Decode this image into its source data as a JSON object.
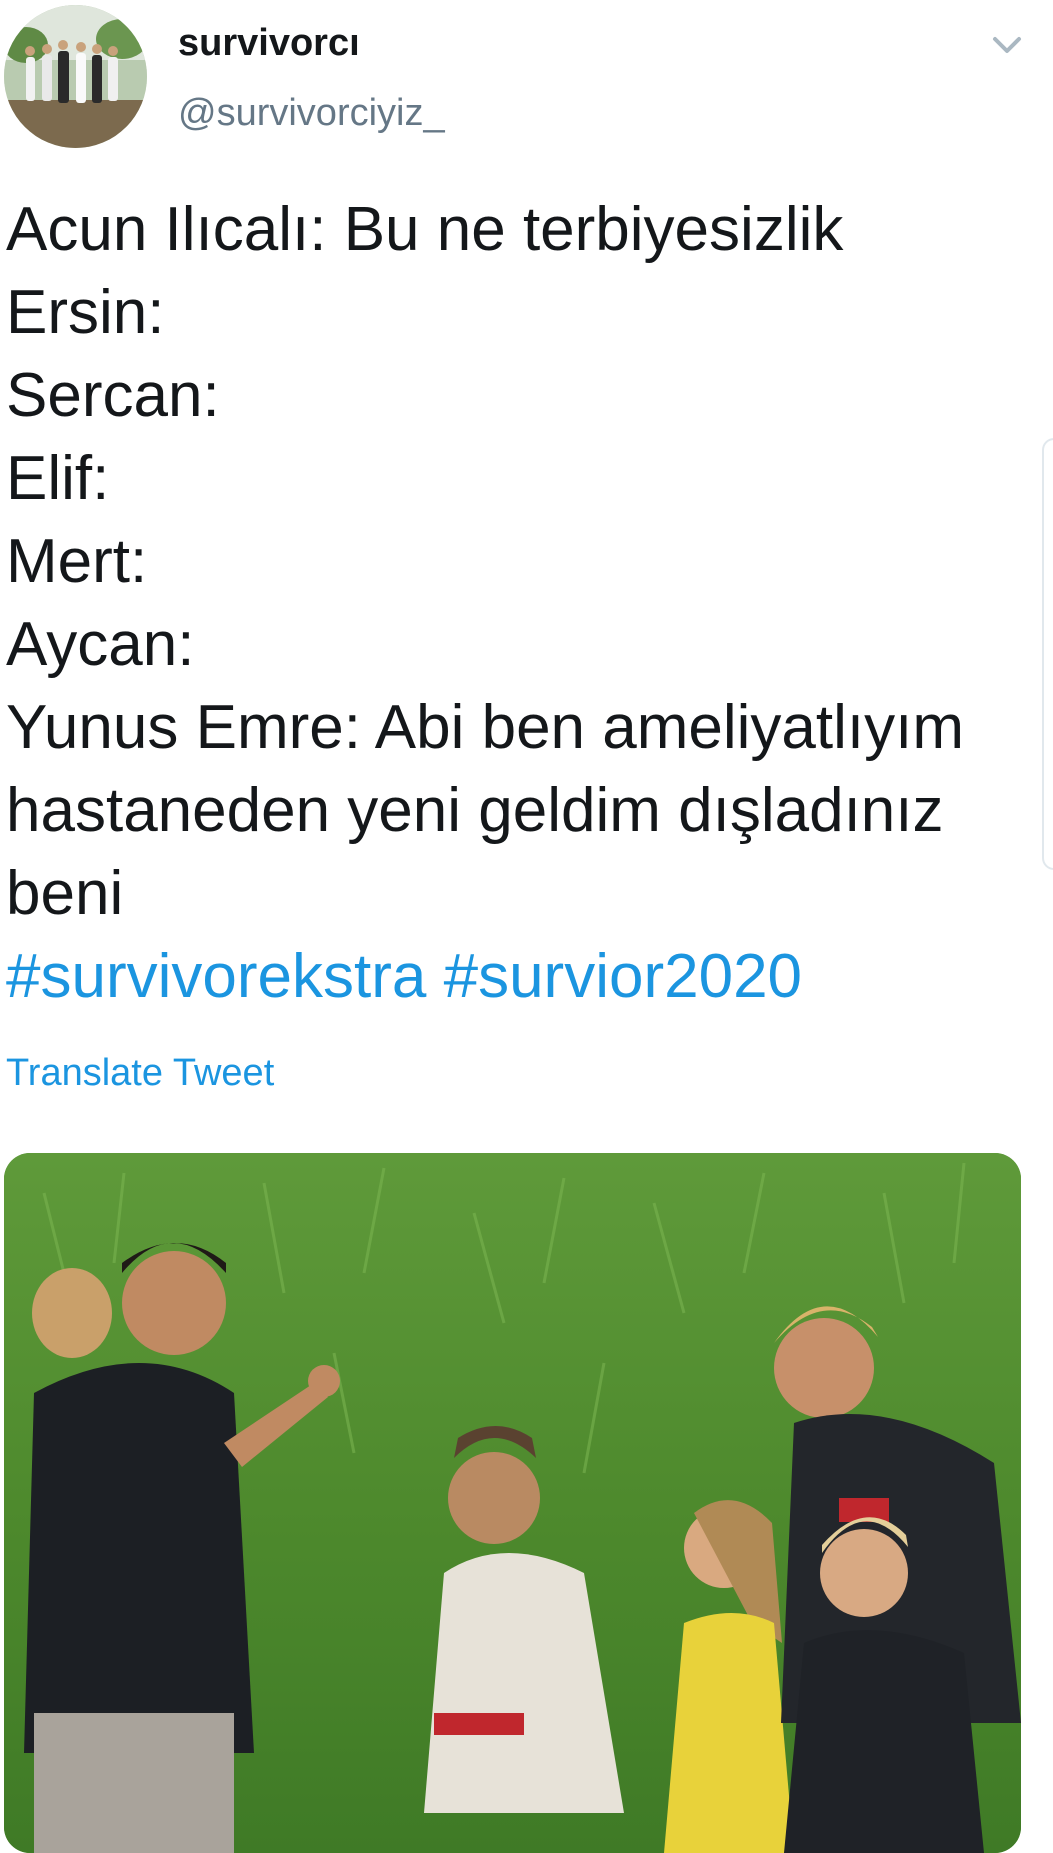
{
  "tweet": {
    "display_name": "survivorcı",
    "handle": "@survivorciyiz_",
    "lines": [
      "Acun Ilıcalı: Bu ne terbiyesizlik",
      "Ersin:",
      "Sercan:",
      "Elif:",
      "Mert:",
      "Aycan:",
      "Yunus Emre: Abi ben ameliyatlıyım",
      "hastaneden yeni geldim dışladınız",
      "beni"
    ],
    "hashtags": [
      "#survivorekstra",
      "#survior2020"
    ],
    "translate_label": "Translate Tweet"
  },
  "icons": {
    "menu": "chevron-down-icon"
  },
  "colors": {
    "link": "#1b95e0",
    "text": "#14171a",
    "secondary": "#657786"
  }
}
